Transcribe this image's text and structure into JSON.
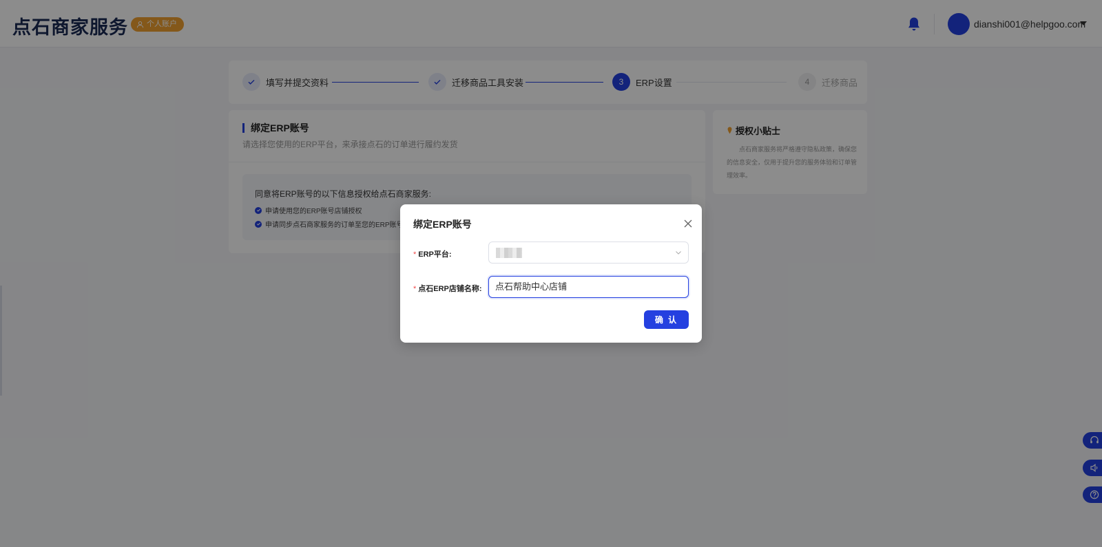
{
  "header": {
    "logo": "点石商家服务",
    "account_badge": "个人账户",
    "user_email": "dianshi001@helpgoo.com"
  },
  "steps": [
    {
      "label": "填写并提交资料",
      "state": "done",
      "number": ""
    },
    {
      "label": "迁移商品工具安装",
      "state": "done",
      "number": ""
    },
    {
      "label": "ERP设置",
      "state": "active",
      "number": "3"
    },
    {
      "label": "迁移商品",
      "state": "todo",
      "number": "4"
    }
  ],
  "main": {
    "section_title": "绑定ERP账号",
    "section_subtitle": "请选择您使用的ERP平台，来承接点石的订单进行履约发货",
    "auth_title": "同意将ERP账号的以下信息授权给点石商家服务:",
    "auth_items": [
      "申请使用您的ERP账号店铺授权",
      "申请同步点石商家服务的订单至您的ERP账号"
    ]
  },
  "tips": {
    "title": "授权小贴士",
    "text": "点石商家服务将严格遵守隐私政策，确保您的信息安全，仅用于提升您的服务体验和订单管理效率。"
  },
  "modal": {
    "title": "绑定ERP账号",
    "platform_label": "ERP平台:",
    "store_label": "点石ERP店铺名称:",
    "store_value": "点石帮助中心店铺",
    "confirm_label": "确 认"
  },
  "colors": {
    "primary": "#2440e0",
    "badge": "#f0a030",
    "required": "#f04848"
  }
}
